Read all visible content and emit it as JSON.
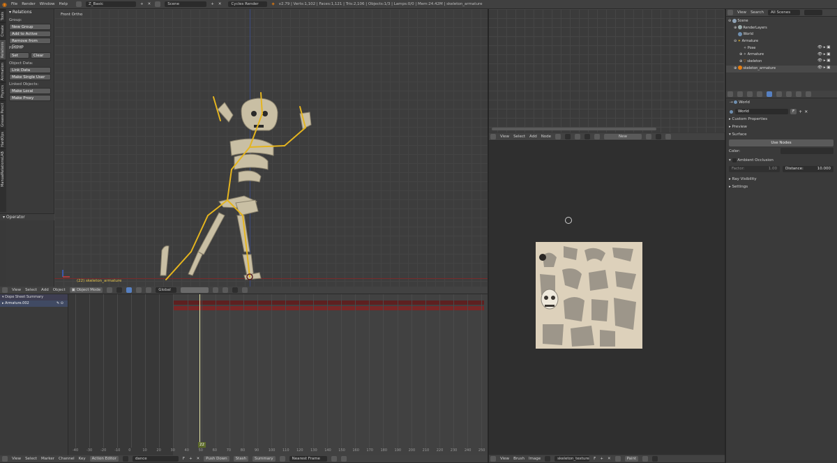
{
  "menu": {
    "items": [
      "File",
      "Render",
      "Window",
      "Help"
    ],
    "screen_layout": "Z_Basic",
    "scene": "Scene",
    "render_engine": "Cycles Render",
    "status": "v2.79 | Verts:1,102 | Faces:1,121 | Tris:2,106 | Objects:1/3 | Lamps:0/0 | Mem:24.42M | skeleton_armature"
  },
  "toolshelf": {
    "title": "Relations",
    "tabs": [
      "Tools",
      "Create",
      "Relations",
      "Animation",
      "Physics",
      "Grease Pencil",
      "HardOps",
      "ManualRelationsLAB"
    ],
    "group_label": "Group:",
    "group_buttons": [
      "New Group",
      "Add to Active",
      "Remove from Group"
    ],
    "parent_label": "Parent:",
    "parent_set": "Set",
    "parent_clear": "Clear",
    "object_data_label": "Object Data:",
    "object_data_buttons": [
      "Link Data",
      "Make Single User"
    ],
    "linked_label": "Linked Objects:",
    "linked_buttons": [
      "Make Local",
      "Make Proxy"
    ],
    "operator_title": "Operator"
  },
  "viewport": {
    "view_name": "Front Ortho",
    "object_info": "(22) skeleton_armature",
    "header": {
      "menus": [
        "View",
        "Select",
        "Add",
        "Object"
      ],
      "mode": "Object Mode",
      "orientation": "Global"
    }
  },
  "dopesheet": {
    "channels": [
      "Dope Sheet Summary",
      "Armature.002"
    ],
    "frame_ticks": [
      "-40",
      "-30",
      "-20",
      "-10",
      "0",
      "10",
      "20",
      "30",
      "40",
      "50",
      "60",
      "70",
      "80",
      "90",
      "100",
      "110",
      "120",
      "130",
      "140",
      "150",
      "160",
      "170",
      "180",
      "190",
      "200",
      "210",
      "220",
      "230",
      "240",
      "250"
    ],
    "current_frame": "22",
    "header": {
      "menus": [
        "View",
        "Select",
        "Marker",
        "Channel",
        "Key"
      ],
      "editor": "Action Editor",
      "action": "dance",
      "push_down": "Push Down",
      "stash": "Stash",
      "summary": "Summary",
      "snap": "Nearest Frame"
    }
  },
  "node_editor": {
    "header": {
      "menus": [
        "View",
        "Select",
        "Add",
        "Node"
      ],
      "new_label": "New"
    }
  },
  "image_editor": {
    "header": {
      "menus": [
        "View",
        "Brush",
        "Image"
      ],
      "image_name": "skeleton_texture",
      "mode": "Paint"
    }
  },
  "outliner": {
    "header": {
      "menus": [
        "View",
        "Search"
      ],
      "filter": "All Scenes"
    },
    "rows": [
      {
        "label": "Scene",
        "indent": 0
      },
      {
        "label": "RenderLayers",
        "indent": 1
      },
      {
        "label": "World",
        "indent": 1
      },
      {
        "label": "Armature",
        "indent": 1
      },
      {
        "label": "Pose",
        "indent": 2
      },
      {
        "label": "Armature",
        "indent": 2
      },
      {
        "label": "skeleton",
        "indent": 2
      },
      {
        "label": "skeleton_armature",
        "indent": 1
      }
    ]
  },
  "properties": {
    "context": "World",
    "world_name": "World",
    "world_users": "F",
    "panels": [
      "Custom Properties",
      "Preview",
      "Surface"
    ],
    "use_nodes": "Use Nodes",
    "color_label": "Color:",
    "ambient_occlusion": "Ambient Occlusion",
    "factor_label": "Factor:",
    "factor_value": "1.00",
    "distance_label": "Distance:",
    "distance_value": "10.000",
    "ray_visibility": "Ray Visibility",
    "settings": "Settings"
  },
  "colors": {
    "background": "#393939",
    "viewport": "#3d3d3d",
    "header": "#424242",
    "bone": "#e5b51f",
    "selection": "#5680c2",
    "keyframe_strip": "#8a1f1f",
    "playhead": "#e8e8a8"
  }
}
